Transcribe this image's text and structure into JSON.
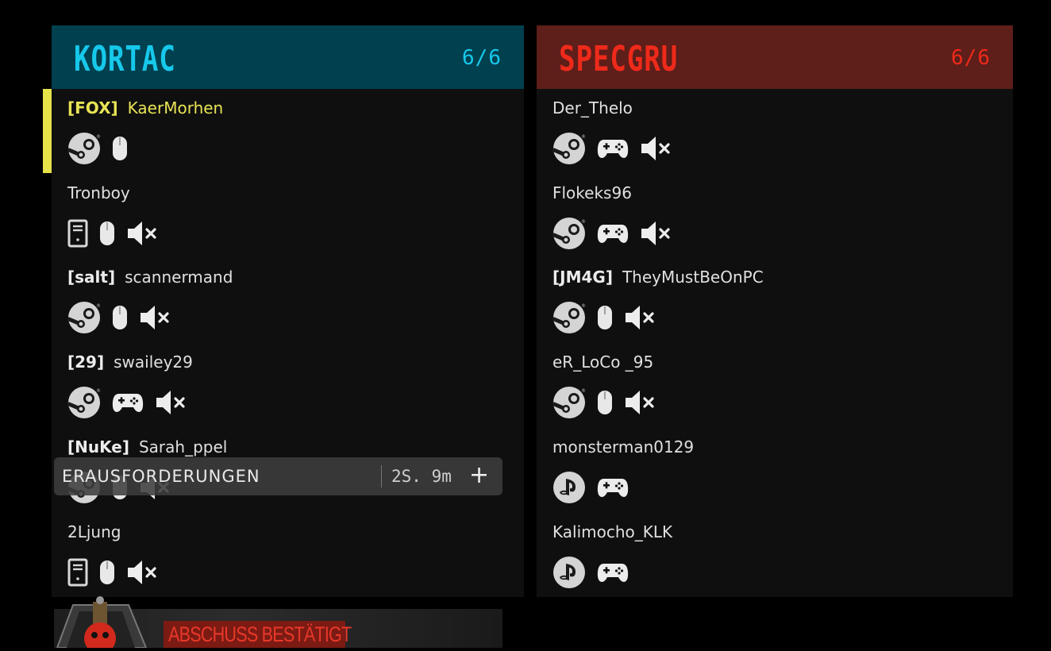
{
  "teams": {
    "left": {
      "name": "KORTAC",
      "count": "6/6",
      "color": "#16c8ea",
      "players": [
        {
          "clan": "[FOX]",
          "name": "KaerMorhen",
          "icons": [
            "steam-icon",
            "mouse-icon"
          ],
          "highlight": true
        },
        {
          "clan": "",
          "name": "Tronboy",
          "icons": [
            "pc-icon",
            "mouse-icon",
            "mute-icon"
          ]
        },
        {
          "clan": "[salt]",
          "name": "scannermand",
          "icons": [
            "steam-icon",
            "mouse-icon",
            "mute-icon"
          ]
        },
        {
          "clan": "[29]",
          "name": "swailey29",
          "icons": [
            "steam-icon",
            "gamepad-icon",
            "mute-icon"
          ]
        },
        {
          "clan": "[NuKe]",
          "name": "Sarah_ppel",
          "icons": [
            "steam-icon",
            "mouse-icon",
            "mute-icon"
          ]
        },
        {
          "clan": "",
          "name": "2Ljung",
          "icons": [
            "pc-icon",
            "mouse-icon",
            "mute-icon"
          ]
        }
      ]
    },
    "right": {
      "name": "SPECGRU",
      "count": "6/6",
      "color": "#ee2a1a",
      "players": [
        {
          "clan": "",
          "name": "Der_Thelo",
          "icons": [
            "steam-icon",
            "gamepad-icon",
            "mute-icon"
          ]
        },
        {
          "clan": "",
          "name": "Flokeks96",
          "icons": [
            "steam-icon",
            "gamepad-icon",
            "mute-icon"
          ]
        },
        {
          "clan": "[JM4G]",
          "name": "TheyMustBeOnPC",
          "icons": [
            "steam-icon",
            "mouse-icon",
            "mute-icon"
          ]
        },
        {
          "clan": "",
          "name": "eR_LoCo _95",
          "icons": [
            "steam-icon",
            "mouse-icon",
            "mute-icon"
          ]
        },
        {
          "clan": "",
          "name": "monsterman0129",
          "icons": [
            "playstation-icon",
            "gamepad-icon"
          ]
        },
        {
          "clan": "",
          "name": "Kalimocho_KLK",
          "icons": [
            "playstation-icon",
            "gamepad-icon"
          ]
        }
      ]
    }
  },
  "toast": {
    "label": "ERAUSFORDERUNGEN",
    "time": "2S. 9m",
    "plus": "+"
  },
  "killfeed": {
    "text": "ABSCHUSS BESTÄTIGT",
    "emblem_icon": "skull-emblem-icon"
  }
}
